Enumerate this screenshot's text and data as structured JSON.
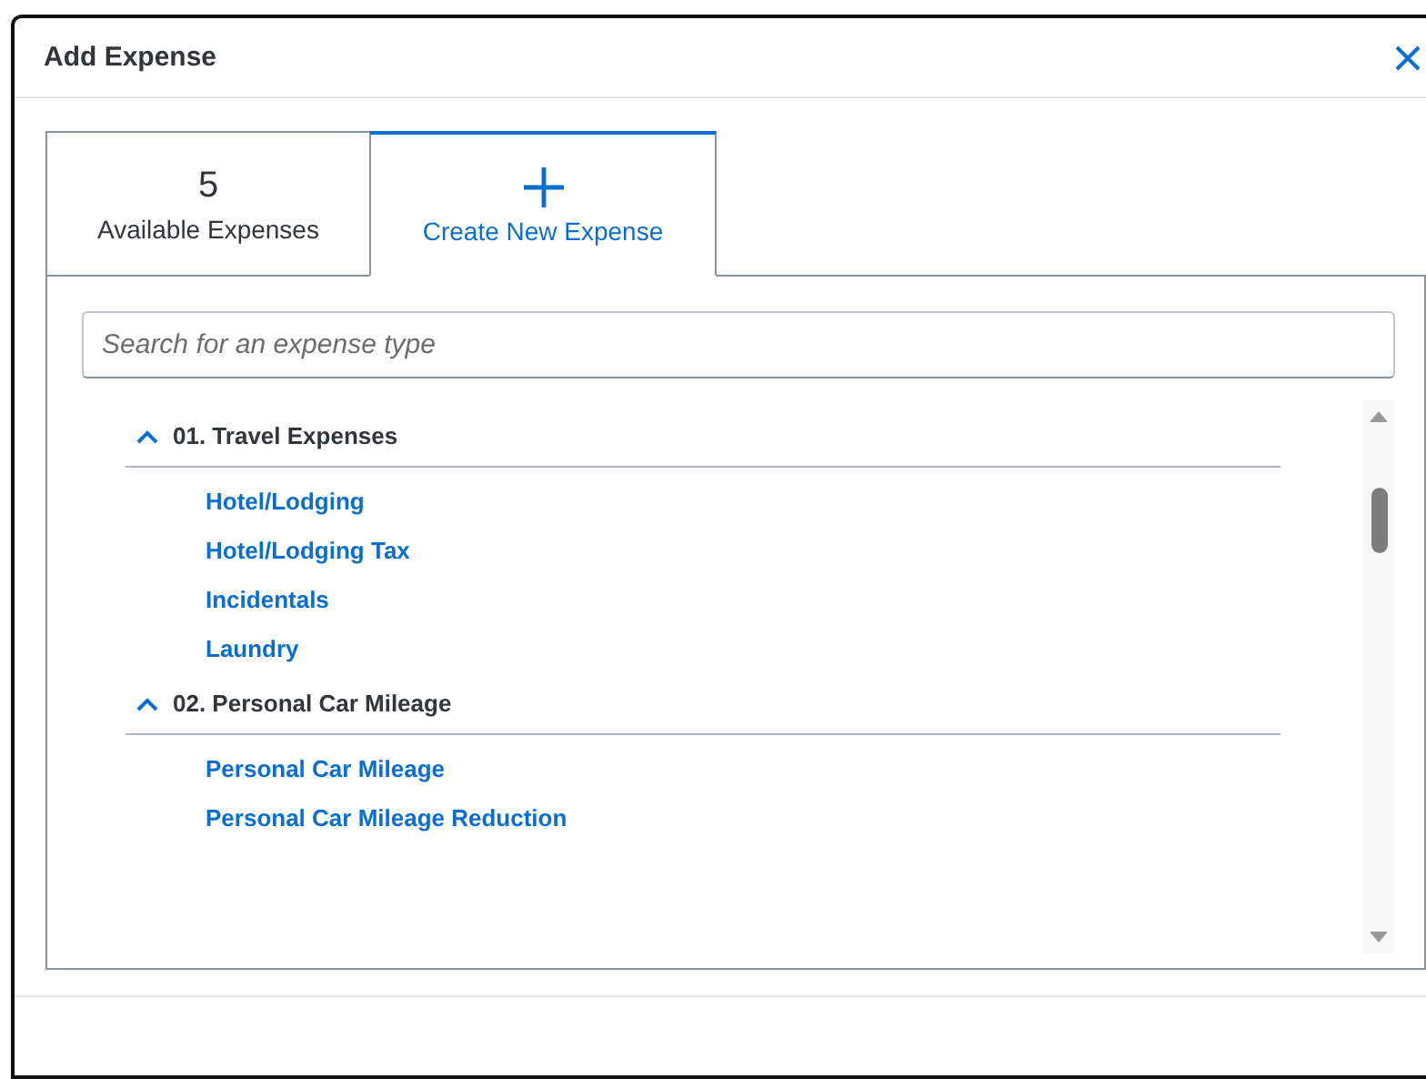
{
  "dialog": {
    "title": "Add Expense"
  },
  "tabs": [
    {
      "kind": "count",
      "count": "5",
      "label": "Available Expenses",
      "selected": false
    },
    {
      "kind": "create",
      "label": "Create New Expense",
      "selected": true
    }
  ],
  "search": {
    "placeholder": "Search for an expense type"
  },
  "groups": [
    {
      "title": "01. Travel Expenses",
      "expanded": true,
      "items": [
        "Hotel/Lodging",
        "Hotel/Lodging Tax",
        "Incidentals",
        "Laundry"
      ]
    },
    {
      "title": "02. Personal Car Mileage",
      "expanded": true,
      "items": [
        "Personal Car Mileage",
        "Personal Car Mileage Reduction"
      ]
    }
  ]
}
